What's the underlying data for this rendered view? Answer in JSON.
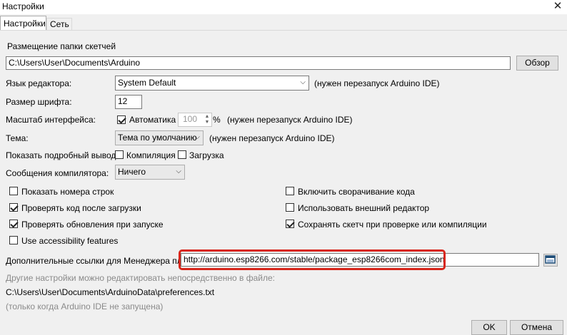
{
  "window": {
    "title": "Настройки",
    "close_glyph": "✕"
  },
  "tabs": [
    {
      "label": "Настройки"
    },
    {
      "label": "Сеть"
    }
  ],
  "sketchbook": {
    "label": "Размещение папки скетчей",
    "value": "C:\\Users\\User\\Documents\\Arduino",
    "browse_label": "Обзор"
  },
  "language": {
    "label": "Язык редактора:",
    "value": "System Default",
    "note": "(нужен перезапуск Arduino IDE)"
  },
  "font_size": {
    "label": "Размер шрифта:",
    "value": "12"
  },
  "scale": {
    "label": "Масштаб интерфейса:",
    "auto_label": "Автоматика",
    "auto_checked": true,
    "value": "100",
    "unit": "%",
    "note": "(нужен перезапуск Arduino IDE)"
  },
  "theme": {
    "label": "Тема:",
    "value": "Тема по умолчанию",
    "note": "(нужен перезапуск Arduino IDE)"
  },
  "verbose": {
    "label": "Показать подробный вывод:",
    "compile_label": "Компиляция",
    "compile_checked": false,
    "upload_label": "Загрузка",
    "upload_checked": false
  },
  "warnings": {
    "label": "Сообщения компилятора:",
    "value": "Ничего"
  },
  "options_left": [
    {
      "label": "Показать номера строк",
      "checked": false
    },
    {
      "label": "Проверять код после загрузки",
      "checked": true
    },
    {
      "label": "Проверять обновления при запуске",
      "checked": true
    },
    {
      "label": "Use accessibility features",
      "checked": false
    }
  ],
  "options_right": [
    {
      "label": "Включить сворачивание кода",
      "checked": false
    },
    {
      "label": "Использовать внешний редактор",
      "checked": false
    },
    {
      "label": "Сохранять скетч при проверке или компиляции",
      "checked": true
    }
  ],
  "board_urls": {
    "label": "Дополнительные ссылки для Менеджера плат:",
    "value": "http://arduino.esp8266.com/stable/package_esp8266com_index.json"
  },
  "more_prefs": {
    "hint": "Другие настройки можно редактировать непосредственно в файле:",
    "path": "C:\\Users\\User\\Documents\\ArduinoData\\preferences.txt",
    "note": "(только когда Arduino IDE не запущена)"
  },
  "buttons": {
    "ok": "OK",
    "cancel": "Отмена"
  },
  "colors": {
    "highlight_border": "#d7261b"
  }
}
